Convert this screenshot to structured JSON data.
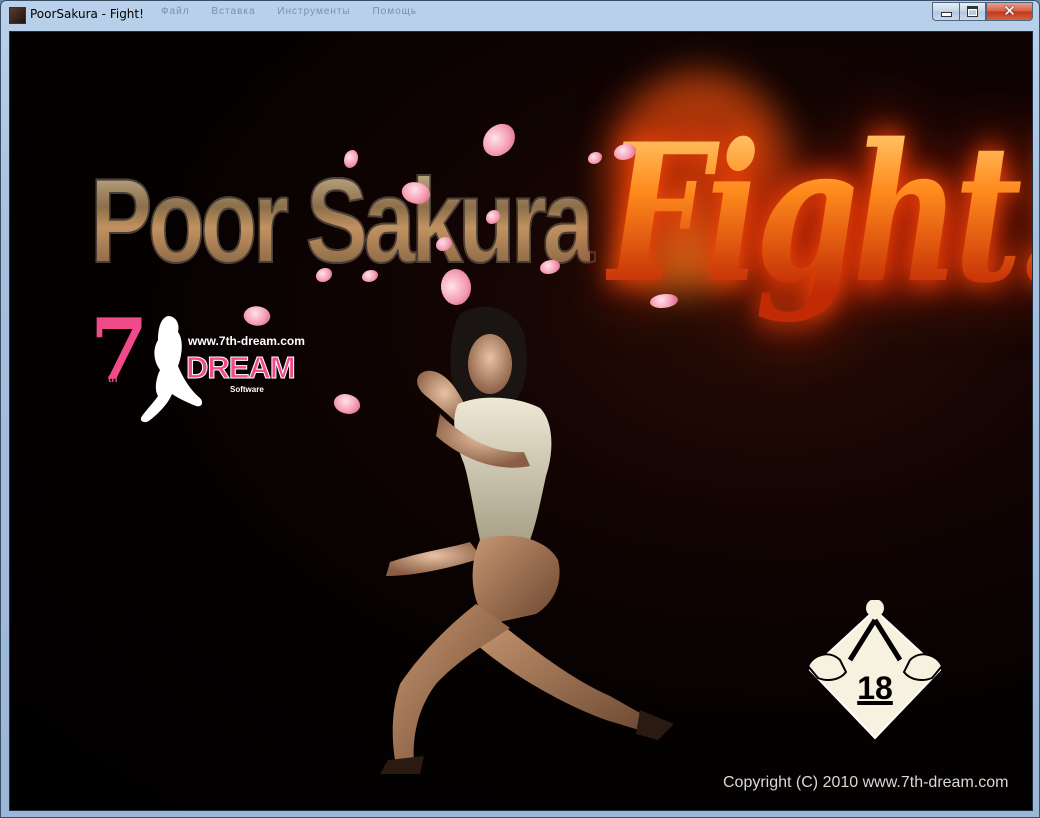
{
  "window": {
    "title": "PoorSakura - Fight!"
  },
  "ghost_menu": [
    "Файл",
    "Вставка",
    "Инструменты",
    "Помощь"
  ],
  "caption": {
    "minimize": "",
    "maximize": "",
    "close": "✕"
  },
  "game": {
    "title_main": "Poor Sakura",
    "title_fight": "Fight!!",
    "logo": {
      "url": "www.7th-dream.com",
      "word": "DREAM",
      "sub": "Software",
      "seven": "7",
      "th": "th"
    },
    "rating": "18",
    "copyright": "Copyright (C) 2010 www.7th-dream.com"
  },
  "colors": {
    "accent_pink": "#f04a8a",
    "fire": "#ff6a14",
    "bg": "#000000"
  },
  "icons": {
    "app": "app-icon",
    "min": "minimize-icon",
    "max": "maximize-icon",
    "close": "close-icon"
  }
}
